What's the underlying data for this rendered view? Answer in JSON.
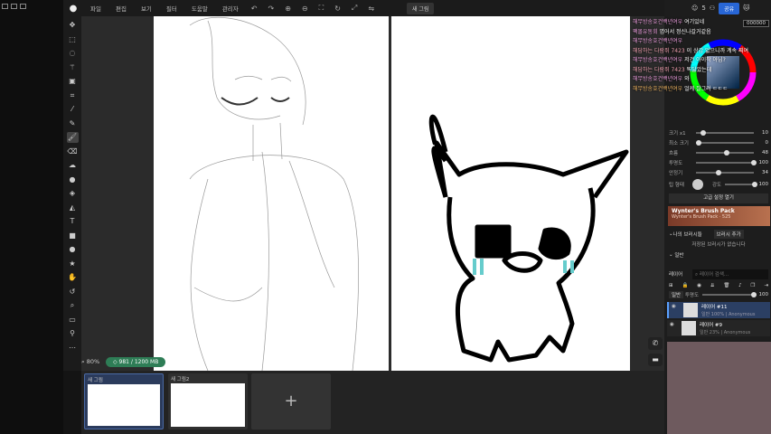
{
  "menu": {
    "items": [
      "파일",
      "편집",
      "보기",
      "필터",
      "도움말",
      "관리자"
    ],
    "new_drawing": "새 그림"
  },
  "topright": {
    "user_count": "5",
    "share": "공유"
  },
  "status": {
    "zoom": "80%",
    "quota": "981 / 1200",
    "quota_unit": "MB"
  },
  "chat": [
    {
      "name": "해무방송호건백년여우",
      "text": "여기있네"
    },
    {
      "name": "팩몰유동회",
      "text": "엽어서 정신나갈거같음"
    },
    {
      "name": "해무방송호건백년여우",
      "text": ""
    },
    {
      "name": "해담하는 다람쥐 7423",
      "text": "이 상갑 없으니까 계속 찌여"
    },
    {
      "name": "해무방송호건백년여우",
      "text": "저건 아이작 아님?"
    },
    {
      "name": "해담하는 다람쥐 7423",
      "text": "똑닮았는데"
    },
    {
      "name": "해무방송호건백년여우",
      "text": "와"
    },
    {
      "name": "해무방송호건백년여우",
      "text": "얼케 잘그려 ㄷㄷㄷ"
    }
  ],
  "color_hex": "000000",
  "brush": {
    "size_label": "크기 x1",
    "size": "10",
    "min_size_label": "최소 크기",
    "min_size": "0",
    "flow_label": "흐름",
    "flow": "48",
    "opacity_label": "투명도",
    "opacity": "100",
    "smooth_label": "안정기",
    "smooth": "34",
    "tip_label": "팁 형태",
    "hardness_label": "강도",
    "hardness": "100",
    "advanced": "고급 설정 열기"
  },
  "brush_pack": {
    "title": "Wynter's Brush Pack",
    "subtitle": "Wynter's Brush Pack · 525"
  },
  "my_brushes": {
    "label": "나의 브러시들",
    "add": "브러시 추가",
    "empty": "저장된 브러시가 없습니다",
    "general": "일반"
  },
  "layers": {
    "label": "레이어",
    "search_placeholder": "레이어 검색...",
    "blend": "일반",
    "opacity_label": "투명도",
    "opacity": "100",
    "items": [
      {
        "name": "레이어 #11",
        "meta": "일반 100% | Anonymous"
      },
      {
        "name": "레이어 #9",
        "meta": "일반 23% | Anonymous"
      }
    ]
  },
  "drawings": [
    {
      "title": "새 그림"
    },
    {
      "title": "새 그림2"
    }
  ],
  "add_drawing": "+"
}
